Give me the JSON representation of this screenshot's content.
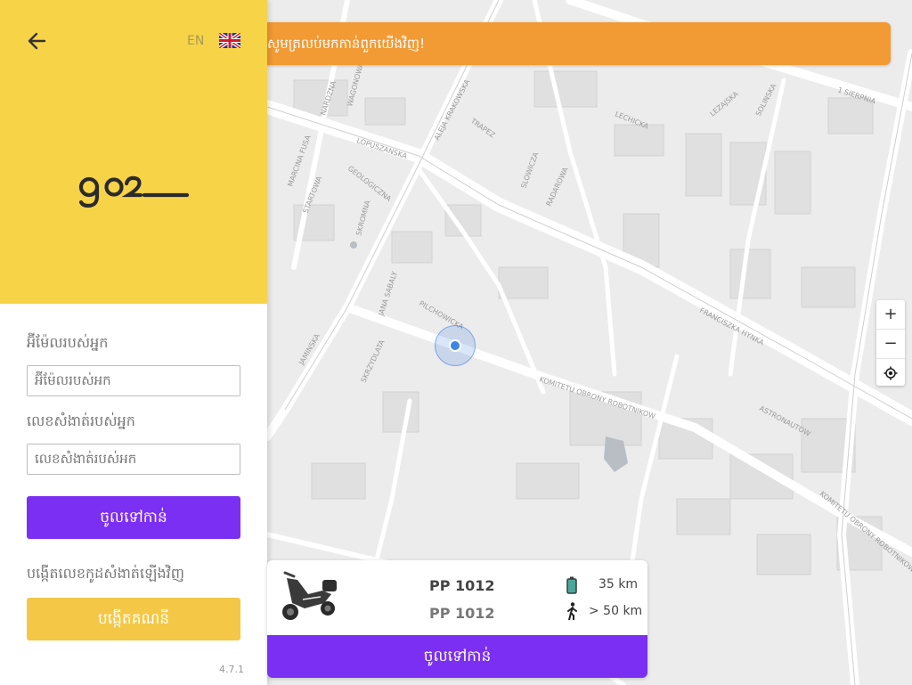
{
  "banner": {
    "text": "សូមត្រលប់មកកាន់ពួកយើងវិញ!"
  },
  "language": {
    "code": "EN"
  },
  "login": {
    "email_label": "អ៊ីម៉ែលរបស់អ្នក",
    "email_placeholder": "អ៊ីម៉ែលរបស់អក",
    "password_label": "លេខសំងាត់របស់អ្នក",
    "password_placeholder": "លេខសំងាត់របស់អក",
    "login_button": "ចូលទៅកាន់",
    "forgot_label": "បង្កើតលេខកូដសំងាត់ឡើងវិញ",
    "create_button": "បង្កើតគណនី"
  },
  "version": "4.7.1",
  "vehicle": {
    "plate_primary": "PP 1012",
    "plate_secondary": "PP 1012",
    "range": "35 km",
    "distance": "> 50 km",
    "action": "ចូលទៅកាន់"
  },
  "map_labels": [
    "LOPUSZANSKA",
    "ALEJA KRAKOWSKA",
    "TRAPEZ",
    "LECHICKA",
    "LEZAJSKA",
    "SOLINSKA",
    "1 SIERPNIA",
    "GEOLOGICZNA",
    "STARTOWA",
    "SKROMNA",
    "SLOWICZA",
    "RADAROWA",
    "JANA SABALY",
    "PILCHOWICKA",
    "SKRZYDLATA",
    "KOMITETU OBRONY ROBOTNIKOW",
    "FRANCISZKA HYNKA",
    "ASTRONAUTOW",
    "MARCINA FUSA",
    "NARDZNA",
    "WAGONOWA",
    "JAMINSKA"
  ],
  "zoom": {
    "in": "+",
    "out": "−"
  }
}
